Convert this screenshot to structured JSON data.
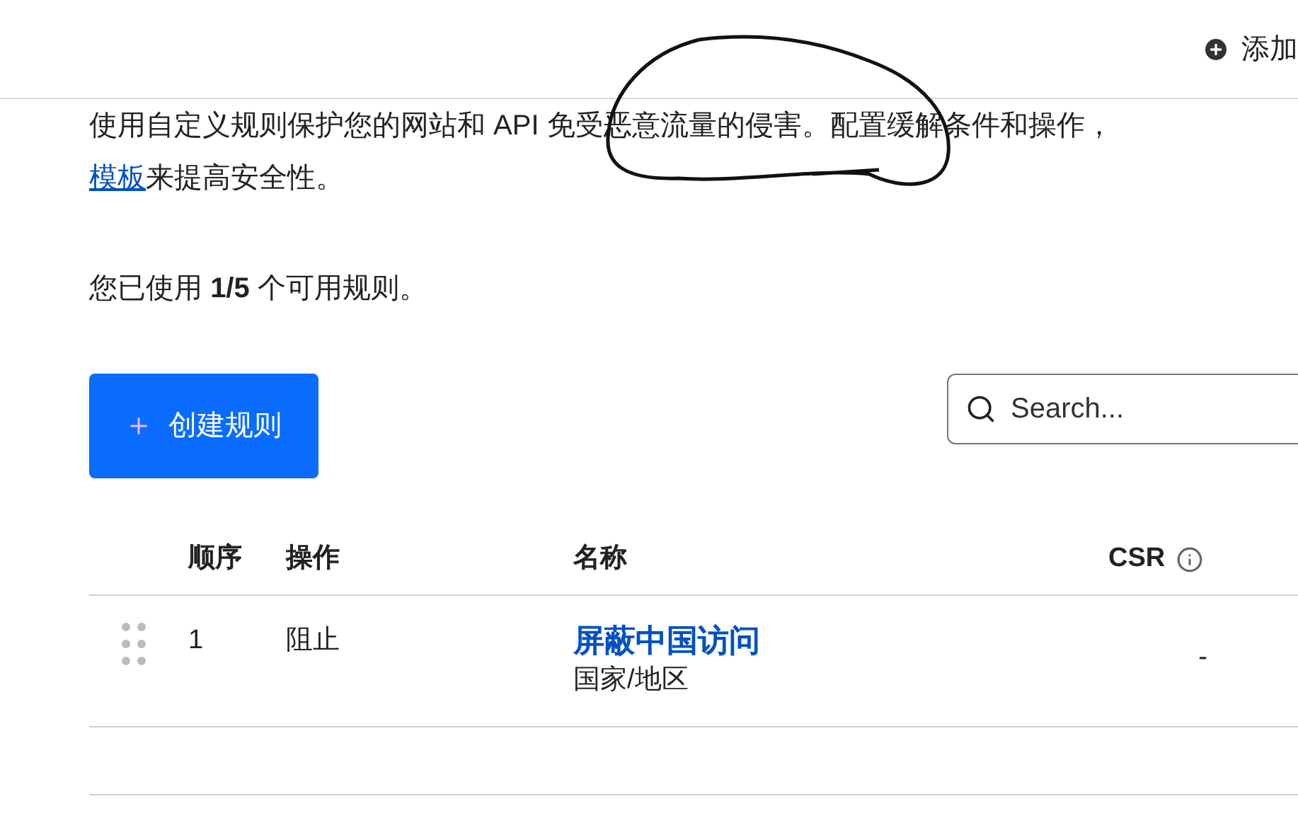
{
  "header": {
    "add_button": "添加"
  },
  "description": {
    "text": "使用自定义规则保护您的网站和 API 免受恶意流量的侵害。配置缓解条件和操作，",
    "link": "模板",
    "text_after": "来提高安全性。"
  },
  "usage": "您已使用 **1/5** 个可用规则。",
  "create_button": "创建规则",
  "search": {
    "placeholder": "Search..."
  },
  "table": {
    "columns": [
      "顺序",
      "操作",
      "名称",
      "CSR"
    ],
    "rows": [
      {
        "order": "1",
        "action": "阻止",
        "name": "屏蔽中国访问",
        "subtitle": "国家/地区",
        "csr": "-"
      }
    ]
  },
  "annotation": {
    "kind": "circle"
  }
}
